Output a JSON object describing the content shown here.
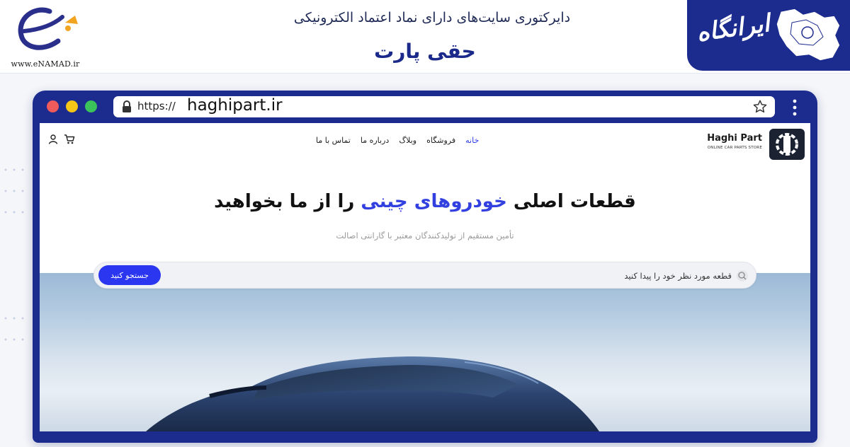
{
  "header": {
    "enamad_url": "www.eNAMAD.ir",
    "directory_title": "دایرکتوری سایت‌های دارای نماد اعتماد الکترونیکی",
    "site_title": "حقی پارت",
    "brand_name": "ایرانگاه"
  },
  "browser": {
    "url_prefix": "https://",
    "url_domain": "haghipart.ir"
  },
  "site": {
    "logo": {
      "name": "Haghi Part",
      "tagline": "ONLINE CAR PARTS STORE"
    },
    "nav": [
      {
        "label": "خانه",
        "active": true
      },
      {
        "label": "فروشگاه",
        "active": false
      },
      {
        "label": "وبلاگ",
        "active": false
      },
      {
        "label": "درباره ما",
        "active": false
      },
      {
        "label": "تماس با ما",
        "active": false
      }
    ],
    "hero": {
      "title_before": "قطعات اصلی ",
      "title_highlight": "خودروهای چینی",
      "title_after": " را از ما بخواهید",
      "subtitle": "تأمین مستقیم از تولیدکنندگان معتبر با گارانتی اصالت"
    },
    "search": {
      "placeholder": "قطعه مورد نظر خود را پیدا کنید",
      "button_label": "جستجو کنید"
    }
  },
  "colors": {
    "brand_blue": "#1b2b8e",
    "accent_blue": "#2a36f0",
    "highlight_blue": "#3340e0"
  }
}
